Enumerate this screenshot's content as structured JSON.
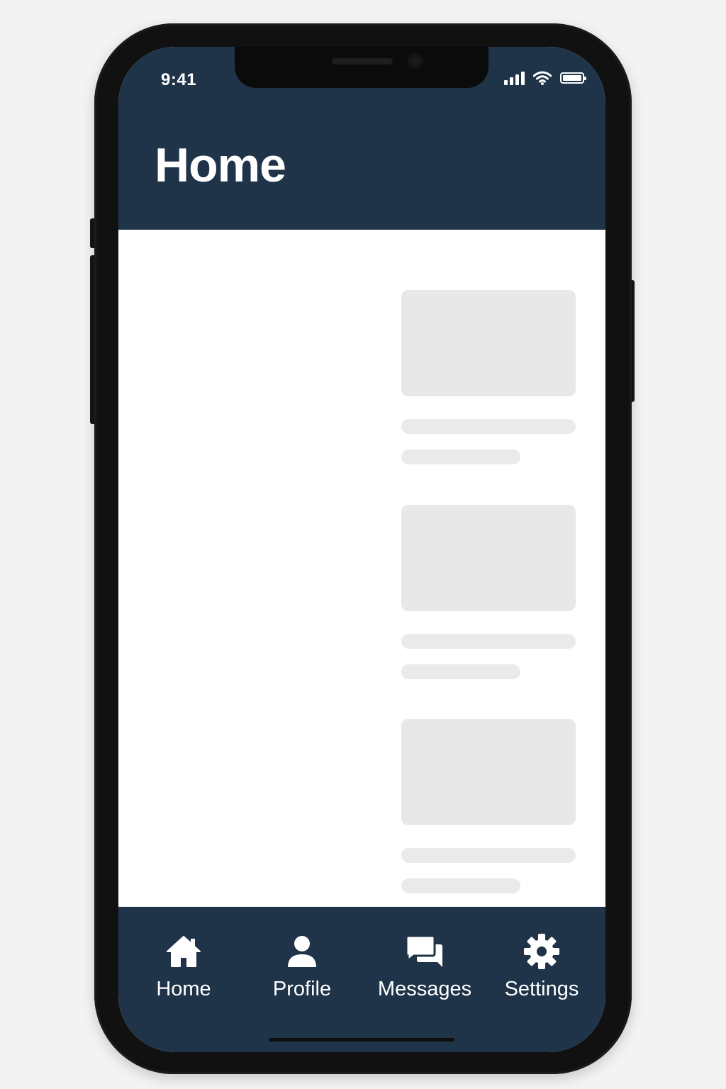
{
  "status_bar": {
    "time": "9:41",
    "icons": [
      "cellular-signal-icon",
      "wifi-icon",
      "battery-icon"
    ]
  },
  "header": {
    "title": "Home"
  },
  "content": {
    "placeholder_cards": 3
  },
  "tab_bar": {
    "items": [
      {
        "label": "Home",
        "icon": "home-icon"
      },
      {
        "label": "Profile",
        "icon": "person-icon"
      },
      {
        "label": "Messages",
        "icon": "chat-bubbles-icon"
      },
      {
        "label": "Settings",
        "icon": "gear-icon"
      }
    ]
  },
  "colors": {
    "bar_background": "#1f3349",
    "foreground": "#ffffff",
    "placeholder": "#e8e8e8",
    "page_background": "#f3f3f3"
  }
}
